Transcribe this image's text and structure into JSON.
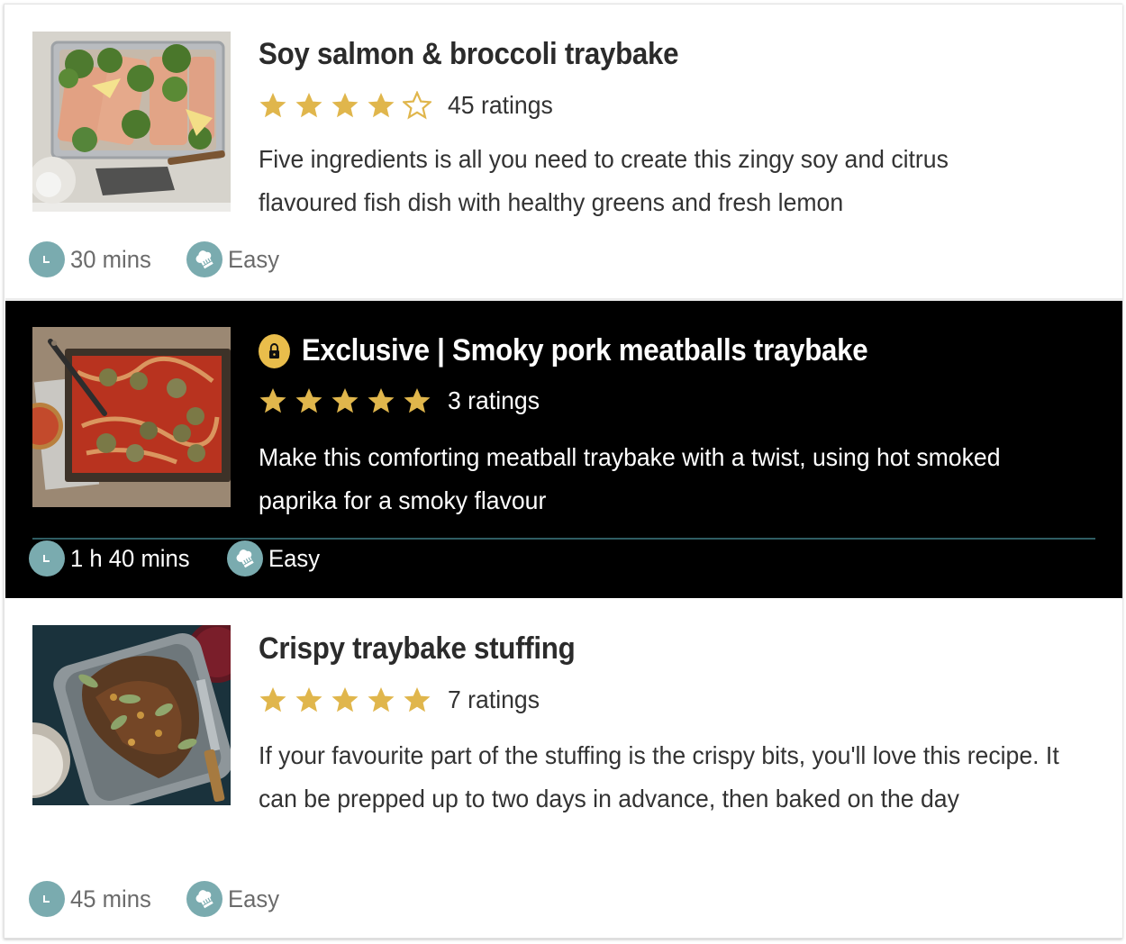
{
  "recipes": [
    {
      "title": "Soy salmon & broccoli traybake",
      "exclusive": false,
      "rating": {
        "value": 4,
        "max": 5,
        "count_label": "45 ratings"
      },
      "description": "Five ingredients is all you need to create this zingy soy and citrus flavoured fish dish with healthy greens and fresh lemon",
      "time": "30 mins",
      "difficulty": "Easy",
      "image_alt": "Salmon fillets with broccoli and lemon wedges in a metal tray"
    },
    {
      "title": "Exclusive | Smoky pork meatballs traybake",
      "exclusive": true,
      "rating": {
        "value": 5,
        "max": 5,
        "count_label": "3 ratings"
      },
      "description": "Make this comforting meatball traybake with a twist, using hot smoked paprika for a smoky flavour",
      "time": "1 h 40 mins",
      "difficulty": "Easy",
      "image_alt": "Meatballs in tomato sauce with melted cheese in a baking tray"
    },
    {
      "title": "Crispy traybake stuffing",
      "exclusive": false,
      "rating": {
        "value": 5,
        "max": 5,
        "count_label": "7 ratings"
      },
      "description": "If your favourite part of the stuffing is the crispy bits, you'll love this recipe. It can be prepped up to two days in advance, then baked on the day",
      "time": "45 mins",
      "difficulty": "Easy",
      "image_alt": "Baked stuffing with sage leaves in a roasting dish"
    }
  ],
  "colors": {
    "star": "#e0b64c",
    "meta_icon": "#7aabaf",
    "lock_badge": "#e9bd4b",
    "exclusive_bg": "#000000",
    "separator": "#2f5d63"
  },
  "icons": {
    "time": "clock-icon",
    "difficulty": "chef-hat-icon",
    "exclusive": "lock-icon",
    "star_full": "star-filled-icon",
    "star_empty": "star-outline-icon"
  }
}
